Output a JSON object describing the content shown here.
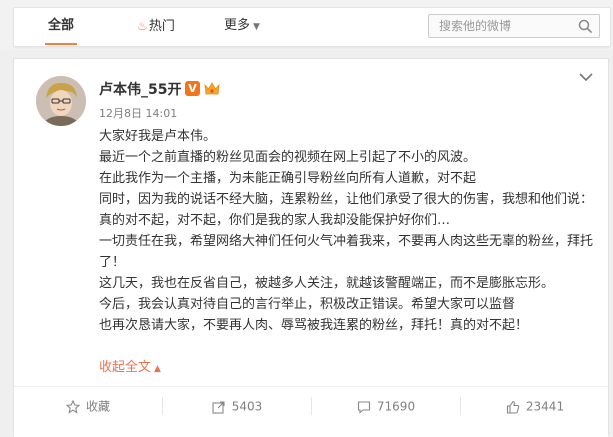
{
  "tabs": {
    "all": "全部",
    "hot": "热门",
    "more": "更多"
  },
  "search": {
    "placeholder": "搜索他的微博"
  },
  "post": {
    "author": "卢本伟_55开",
    "vip_badge": "V",
    "timestamp": "12月8日 14:01",
    "paragraphs": [
      "大家好我是卢本伟。",
      "最近一个之前直播的粉丝见面会的视频在网上引起了不小的风波。",
      "在此我作为一个主播，为未能正确引导粉丝向所有人道歉，对不起",
      "同时，因为我的说话不经大脑，连累粉丝，让他们承受了很大的伤害，我想和他们说：真的对不起，对不起，你们是我的家人我却没能保护好你们…",
      "一切责任在我，希望网络大神们任何火气冲着我来，不要再人肉这些无辜的粉丝，拜托了！",
      "这几天，我也在反省自己，被越多人关注，就越该警醒端正，而不是膨胀忘形。",
      "今后，我会认真对待自己的言行举止，积极改正错误。希望大家可以监督",
      "也再次恳请大家，不要再人肉、辱骂被我连累的粉丝，拜托！真的对不起！"
    ],
    "collapse_label": "收起全文"
  },
  "actions": {
    "favorite": "收藏",
    "reposts": "5403",
    "comments": "71690",
    "likes": "23441"
  },
  "colors": {
    "accent": "#fa7d3c",
    "link": "#eb7350",
    "badge": "#f3751b"
  }
}
